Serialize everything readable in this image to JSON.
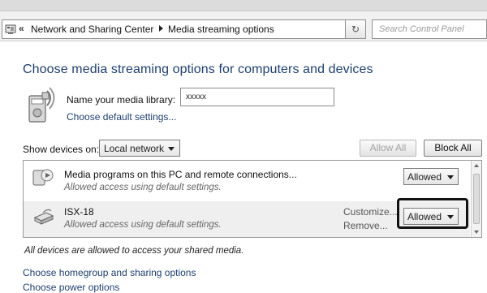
{
  "address_bar": {
    "chevron": "«",
    "crumbs": [
      "Network and Sharing Center",
      "Media streaming options"
    ],
    "refresh_symbol": "↻",
    "search_placeholder": "Search Control Panel"
  },
  "page": {
    "title": "Choose media streaming options for computers and devices",
    "library_label": "Name your media library:",
    "library_value": "xxxxx",
    "default_settings_link": "Choose default settings...",
    "show_devices_label": "Show devices on:",
    "network_selected": "Local network",
    "allow_all_label": "Allow All",
    "block_all_label": "Block All"
  },
  "devices": [
    {
      "name": "Media programs on this PC and remote connections...",
      "subtitle": "Allowed access using default settings.",
      "access": "Allowed",
      "icon": "media-player-icon"
    },
    {
      "name": "ISX-18",
      "subtitle": "Allowed access using default settings.",
      "customize_link": "Customize...",
      "remove_link": "Remove...",
      "access": "Allowed",
      "icon": "receiver-device-icon"
    }
  ],
  "status_text": "All devices are allowed to access your shared media.",
  "bottom_links": [
    "Choose homegroup and sharing options",
    "Choose power options"
  ],
  "colors": {
    "link": "#1e3f6e",
    "title": "#1e3f6e",
    "highlight_border": "#111111"
  }
}
